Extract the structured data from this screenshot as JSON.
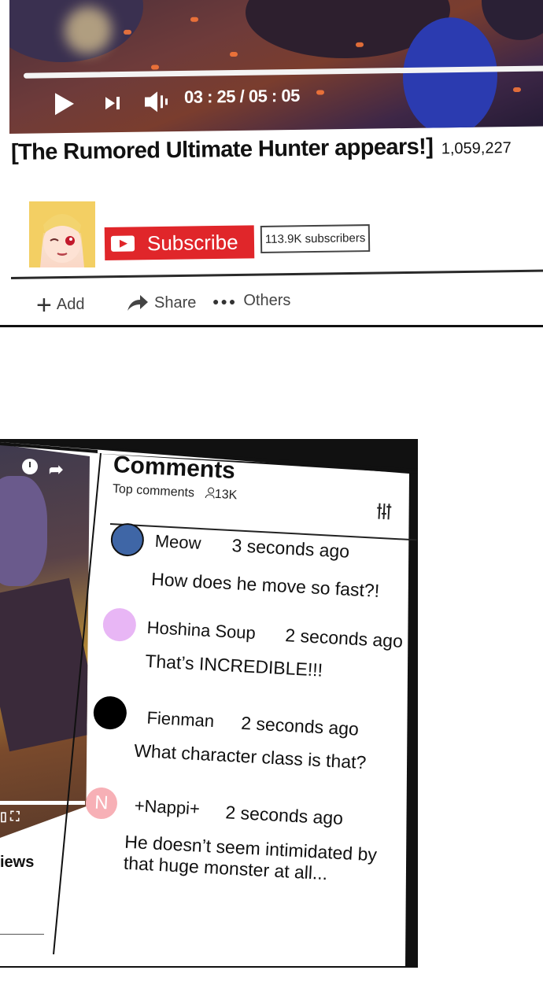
{
  "video": {
    "time": "03 : 25 / 05 : 05",
    "title": "[The Rumored Ultimate Hunter appears!]",
    "views": "1,059,227",
    "progress_fraction": 1.0
  },
  "channel": {
    "subscribe_label": "Subscribe",
    "subscribers": "113.9K subscribers"
  },
  "actions": {
    "add": "Add",
    "share": "Share",
    "others": "Others"
  },
  "comments": {
    "title": "Comments",
    "sort_label": "Top comments",
    "count": "13K",
    "items": [
      {
        "name": "Meow",
        "time": "3 seconds ago",
        "text": "How does he move so fast?!",
        "avatar_color": "#3f66a6",
        "avatar_letter": ""
      },
      {
        "name": "Hoshina Soup",
        "time": "2 seconds ago",
        "text": "That’s INCREDIBLE!!!",
        "avatar_color": "#e8b6f5",
        "avatar_letter": ""
      },
      {
        "name": "Fienman",
        "time": "2 seconds ago",
        "text": "What character class is that?",
        "avatar_color": "#000000",
        "avatar_letter": ""
      },
      {
        "name": "+Nappi+",
        "time": "2 seconds ago",
        "text": "He doesn’t seem intimidated by that huge monster at all...",
        "avatar_color": "#f7b0b6",
        "avatar_letter": "N"
      }
    ]
  },
  "left_panel": {
    "views_fragment": "iews"
  }
}
